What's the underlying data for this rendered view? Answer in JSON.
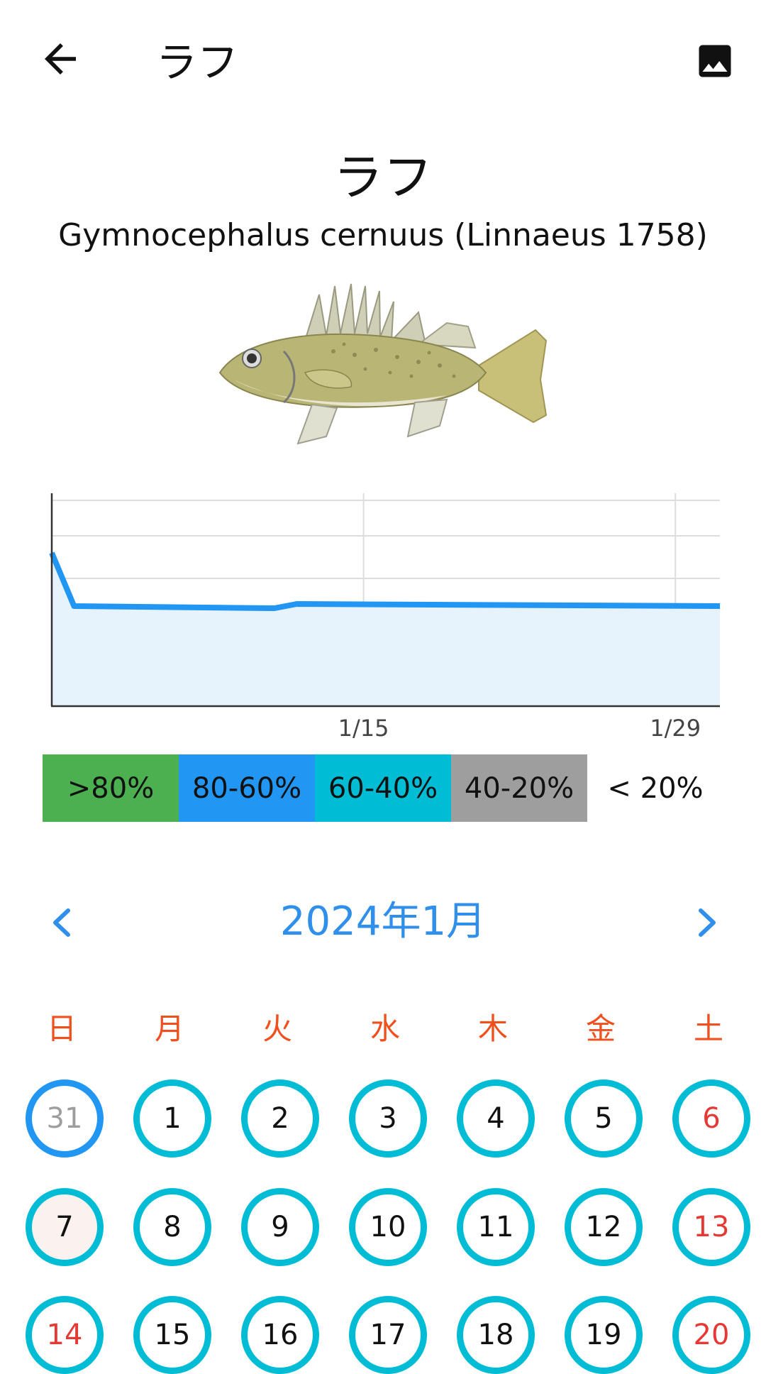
{
  "appbar": {
    "title": "ラフ",
    "back_icon": "arrow-back-icon",
    "gallery_icon": "image-icon"
  },
  "species": {
    "name": "ラフ",
    "scientific": "Gymnocephalus cernuus (Linnaeus 1758)",
    "image": "ruffe-fish-illustration"
  },
  "chart_data": {
    "type": "area",
    "x_tick_labels": [
      "1/15",
      "1/29"
    ],
    "ylim": [
      0,
      100
    ],
    "grid": true,
    "color": "#2196f3",
    "fill": "#e6f3fd",
    "points": [
      {
        "x": "2024-01-01",
        "y": 72
      },
      {
        "x": "2024-01-02",
        "y": 47
      },
      {
        "x": "2024-01-11",
        "y": 46
      },
      {
        "x": "2024-01-12",
        "y": 48
      },
      {
        "x": "2024-01-31",
        "y": 47
      }
    ]
  },
  "legend": [
    {
      "label": ">80%",
      "color": "#4caf50"
    },
    {
      "label": "80-60%",
      "color": "#2196f3"
    },
    {
      "label": "60-40%",
      "color": "#00bcd4"
    },
    {
      "label": "40-20%",
      "color": "#9e9e9e"
    },
    {
      "label": "< 20%",
      "color": "#ffffff"
    }
  ],
  "calendar": {
    "month_label": "2024年1月",
    "prev_icon": "chevron-left-icon",
    "next_icon": "chevron-right-icon",
    "weekdays": [
      "日",
      "月",
      "火",
      "水",
      "木",
      "金",
      "土"
    ],
    "rows": [
      [
        "31",
        "1",
        "2",
        "3",
        "4",
        "5",
        "6"
      ],
      [
        "7",
        "8",
        "9",
        "10",
        "11",
        "12",
        "13"
      ],
      [
        "14",
        "15",
        "16",
        "17",
        "18",
        "19",
        "20"
      ]
    ],
    "other_month_days": [
      "31"
    ],
    "today": "7",
    "weekend_red_days": [
      "6",
      "13",
      "14",
      "20"
    ]
  }
}
